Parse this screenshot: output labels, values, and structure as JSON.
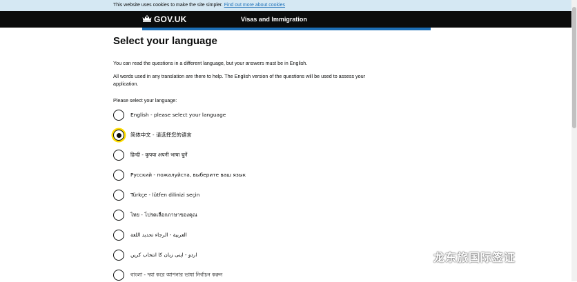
{
  "cookie_banner": {
    "text": "This website uses cookies to make the site simpler.",
    "link": "Find out more about cookies"
  },
  "header": {
    "logo": "GOV.UK",
    "service": "Visas and Immigration"
  },
  "page": {
    "title": "Select your language",
    "paragraph1": "You can read the questions in a different language, but your answers must be in English.",
    "paragraph2": "All words used in any translation are there to help. The English version of the questions will be used to assess your application.",
    "prompt": "Please select your language:"
  },
  "options": [
    {
      "label": "English - please select your language",
      "selected": false
    },
    {
      "label": "简体中文 - 请选择您的语言",
      "selected": true
    },
    {
      "label": "हिन्दी - कृपया अपनी भाषा चुनें",
      "selected": false
    },
    {
      "label": "Русский - пожалуйста, выберите ваш язык",
      "selected": false
    },
    {
      "label": "Türkçe - lütfen dilinizi seçin",
      "selected": false
    },
    {
      "label": "ไทย - โปรดเลือกภาษาของคุณ",
      "selected": false
    },
    {
      "label": "العربية - الرجاء تحديد اللغة",
      "selected": false
    },
    {
      "label": "اردو - اپنی زبان کا انتخاب کریں",
      "selected": false
    },
    {
      "label": "বাংলা - দয়া করে আপনার ভাষা নির্বাচন করুন",
      "selected": false
    }
  ],
  "watermark": {
    "icon": "wechat-icon",
    "text": "龙东旅国际签证"
  },
  "colors": {
    "header_bg": "#0b0c0c",
    "accent_blue": "#1d70b8",
    "cookie_bg": "#d5e8f3",
    "focus_yellow": "#ffdd00"
  }
}
